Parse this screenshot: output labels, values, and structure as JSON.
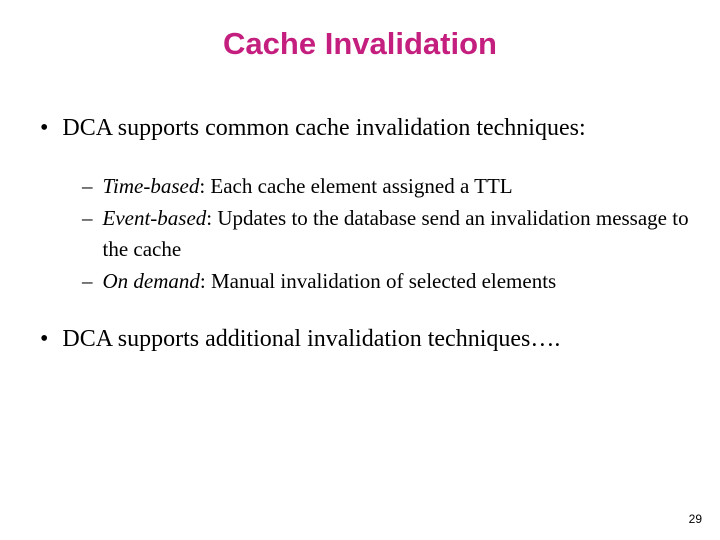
{
  "title": "Cache Invalidation",
  "bullets": {
    "b1": "DCA supports common cache invalidation techniques:",
    "b2": "DCA supports additional invalidation techniques…."
  },
  "sub": {
    "s1_label": "Time-based",
    "s1_text": ": Each cache element assigned a TTL",
    "s2_label": "Event-based",
    "s2_text": ": Updates to the database send an invalidation message to the cache",
    "s3_label": "On demand",
    "s3_text": ": Manual invalidation of selected elements"
  },
  "page_number": "29"
}
